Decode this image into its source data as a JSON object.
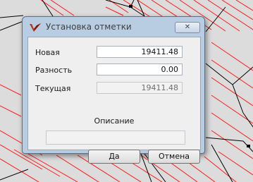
{
  "dialog": {
    "title": "Установка отметки",
    "close_glyph": "✕"
  },
  "fields": [
    {
      "label": "Новая",
      "value": "19411.48",
      "editable": true
    },
    {
      "label": "Разность",
      "value": "0.00",
      "editable": true
    },
    {
      "label": "Текущая",
      "value": "19411.48",
      "editable": false
    }
  ],
  "description": {
    "label": "Описание",
    "value": ""
  },
  "buttons": {
    "ok": "Да",
    "cancel": "Отмена"
  },
  "colors": {
    "hatch": "#ff1a1a",
    "edges": "#000000",
    "background": "#dcdcdc",
    "dialog_frame": "#b9cde2",
    "app_icon": "#c0311a"
  },
  "icons": {
    "app": "red-check-logo-icon",
    "close": "close-icon"
  }
}
